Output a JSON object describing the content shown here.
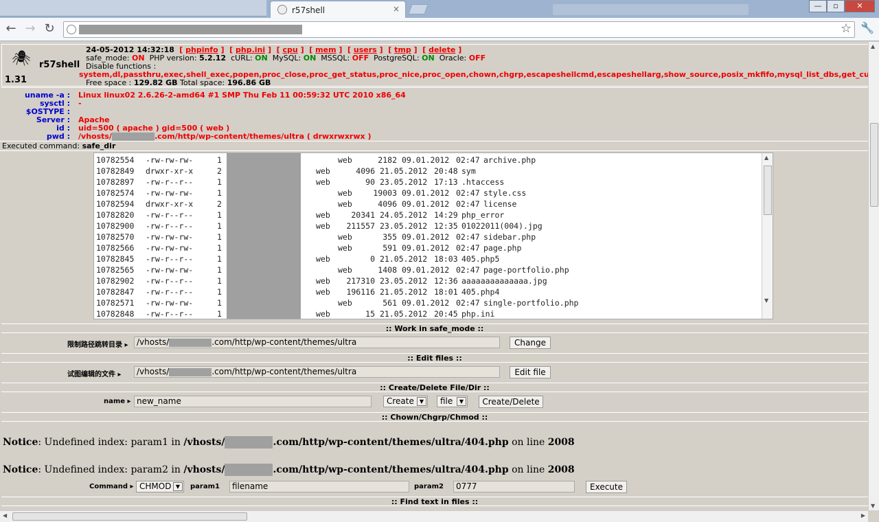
{
  "browser": {
    "tab_title": "r57shell",
    "tab_close": "×",
    "win_minimize": "—",
    "win_maximize": "▫",
    "win_close": "✕"
  },
  "shell": {
    "brand": "r57shell",
    "version": "1.31",
    "datetime": "24-05-2012 14:32:18",
    "links": [
      "phpinfo",
      "php.ini",
      "cpu",
      "mem",
      "users",
      "tmp",
      "delete"
    ],
    "status": {
      "safe_mode_label": "safe_mode:",
      "safe_mode": "ON",
      "php_label": "PHP version:",
      "php": "5.2.12",
      "curl_label": "cURL:",
      "curl": "ON",
      "mysql_label": "MySQL:",
      "mysql": "ON",
      "mssql_label": "MSSQL:",
      "mssql": "OFF",
      "pg_label": "PostgreSQL:",
      "pg": "ON",
      "oracle_label": "Oracle:",
      "oracle": "OFF"
    },
    "disable_label": "Disable functions :",
    "disabled_functions": "system,dl,passthru,exec,shell_exec,popen,proc_close,proc_get_status,proc_nice,proc_open,chown,chgrp,escapeshellcmd,escapeshellarg,show_source,posix_mkfifo,mysql_list_dbs,get_current_user,g",
    "free_space_label": "Free space :",
    "free_space": "129.82 GB",
    "total_space_label": "Total space:",
    "total_space": "196.86 GB"
  },
  "sysinfo": [
    {
      "label": "uname -a :",
      "value": "Linux linux02 2.6.26-2-amd64 #1 SMP Thu Feb 11 00:59:32 UTC 2010 x86_64"
    },
    {
      "label": "sysctl :",
      "value": "-"
    },
    {
      "label": "$OSTYPE :",
      "value": ""
    },
    {
      "label": "Server :",
      "value": "Apache"
    },
    {
      "label": "id :",
      "value": "uid=500 ( apache ) gid=500 ( web )"
    },
    {
      "label": "pwd :",
      "value_prefix": "/vhosts/",
      "value_suffix": ".com/http/wp-content/themes/ultra   ( drwxrwxrwx )"
    }
  ],
  "executed": {
    "label": "Executed command:",
    "command": "safe_dir"
  },
  "listing": [
    {
      "inode": "10782554",
      "perm": "-rw-rw-rw-",
      "links": "1",
      "group": "web",
      "size": "2182",
      "date": "09.01.2012",
      "time": "02:47",
      "name": "archive.php",
      "indent": 1
    },
    {
      "inode": "10782849",
      "perm": "drwxr-xr-x",
      "links": "2",
      "group": "web",
      "size": "4096",
      "date": "21.05.2012",
      "time": "20:48",
      "name": "sym",
      "indent": 0
    },
    {
      "inode": "10782897",
      "perm": "-rw-r--r--",
      "links": "1",
      "group": "web",
      "size": "90",
      "date": "23.05.2012",
      "time": "17:13",
      "name": ".htaccess",
      "indent": 0
    },
    {
      "inode": "10782574",
      "perm": "-rw-rw-rw-",
      "links": "1",
      "group": "web",
      "size": "19003",
      "date": "09.01.2012",
      "time": "02:47",
      "name": "style.css",
      "indent": 1
    },
    {
      "inode": "10782594",
      "perm": "drwxr-xr-x",
      "links": "2",
      "group": "web",
      "size": "4096",
      "date": "09.01.2012",
      "time": "02:47",
      "name": "license",
      "indent": 1
    },
    {
      "inode": "10782820",
      "perm": "-rw-r--r--",
      "links": "1",
      "group": "web",
      "size": "20341",
      "date": "24.05.2012",
      "time": "14:29",
      "name": "php_error",
      "indent": 0
    },
    {
      "inode": "10782900",
      "perm": "-rw-r--r--",
      "links": "1",
      "group": "web",
      "size": "211557",
      "date": "23.05.2012",
      "time": "12:35",
      "name": "01022011(004).jpg",
      "indent": 0
    },
    {
      "inode": "10782570",
      "perm": "-rw-rw-rw-",
      "links": "1",
      "group": "web",
      "size": "355",
      "date": "09.01.2012",
      "time": "02:47",
      "name": "sidebar.php",
      "indent": 1
    },
    {
      "inode": "10782566",
      "perm": "-rw-rw-rw-",
      "links": "1",
      "group": "web",
      "size": "591",
      "date": "09.01.2012",
      "time": "02:47",
      "name": "page.php",
      "indent": 1
    },
    {
      "inode": "10782845",
      "perm": "-rw-r--r--",
      "links": "1",
      "group": "web",
      "size": "0",
      "date": "21.05.2012",
      "time": "18:03",
      "name": "405.php5",
      "indent": 0
    },
    {
      "inode": "10782565",
      "perm": "-rw-rw-rw-",
      "links": "1",
      "group": "web",
      "size": "1408",
      "date": "09.01.2012",
      "time": "02:47",
      "name": "page-portfolio.php",
      "indent": 1
    },
    {
      "inode": "10782902",
      "perm": "-rw-r--r--",
      "links": "1",
      "group": "web",
      "size": "217310",
      "date": "23.05.2012",
      "time": "12:36",
      "name": "aaaaaaaaaaaaaa.jpg",
      "indent": 0
    },
    {
      "inode": "10782847",
      "perm": "-rw-r--r--",
      "links": "1",
      "group": "web",
      "size": "196116",
      "date": "21.05.2012",
      "time": "18:01",
      "name": "405.php4",
      "indent": 0
    },
    {
      "inode": "10782571",
      "perm": "-rw-rw-rw-",
      "links": "1",
      "group": "web",
      "size": "561",
      "date": "09.01.2012",
      "time": "02:47",
      "name": "single-portfolio.php",
      "indent": 1
    },
    {
      "inode": "10782848",
      "perm": "-rw-r--r--",
      "links": "1",
      "group": "web",
      "size": "15",
      "date": "21.05.2012",
      "time": "20:45",
      "name": "php.ini",
      "indent": 0
    }
  ],
  "safe_mode_section": {
    "title": ":: Work in safe_mode ::",
    "label": "限制路径跳转目录",
    "path_prefix": "/vhosts/",
    "path_suffix": ".com/http/wp-content/themes/ultra",
    "button": "Change"
  },
  "edit_section": {
    "title": ":: Edit files ::",
    "label": "试图编辑的文件",
    "path_prefix": "/vhosts/",
    "path_suffix": ".com/http/wp-content/themes/ultra",
    "button": "Edit file"
  },
  "create_section": {
    "title": ":: Create/Delete File/Dir ::",
    "label": "name",
    "value": "new_name",
    "action_select": "Create",
    "type_select": "file",
    "button": "Create/Delete"
  },
  "chown_section": {
    "title": ":: Chown/Chgrp/Chmod ::",
    "notices": [
      {
        "prefix": "Notice",
        "text": ": Undefined index: param1 in ",
        "path_prefix": "/vhosts/",
        "path_suffix": ".com/http/wp-content/themes/ultra/404.php",
        "on_line": " on line ",
        "line": "2008"
      },
      {
        "prefix": "Notice",
        "text": ": Undefined index: param2 in ",
        "path_prefix": "/vhosts/",
        "path_suffix": ".com/http/wp-content/themes/ultra/404.php",
        "on_line": " on line ",
        "line": "2008"
      }
    ],
    "command_label": "Command",
    "command_value": "CHMOD",
    "param1_label": "param1",
    "param1_value": "filename",
    "param2_label": "param2",
    "param2_value": "0777",
    "button": "Execute"
  },
  "find_section": {
    "title": ":: Find text in files ::"
  },
  "colors": {
    "accent_red": "#ee0000",
    "on_green": "#008800",
    "label_blue": "#0000cc",
    "page_bg": "#d4d0c8"
  }
}
